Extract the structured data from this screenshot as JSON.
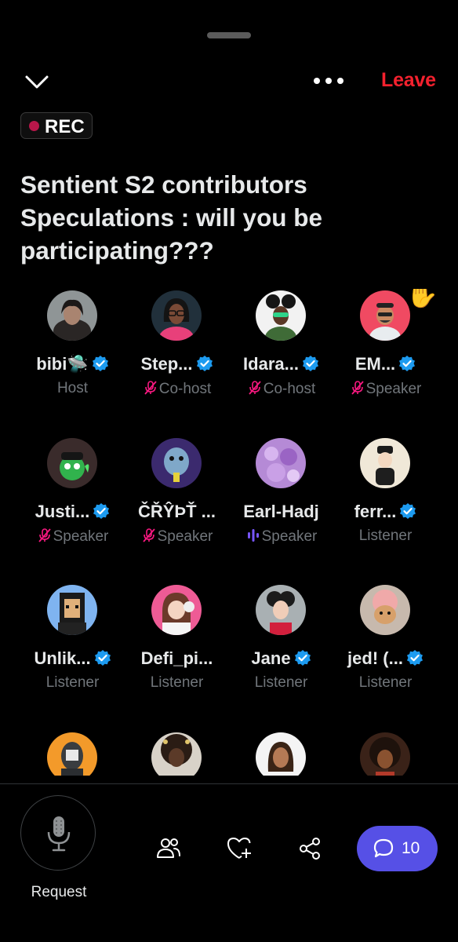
{
  "header": {
    "leave_label": "Leave",
    "rec_label": "REC"
  },
  "space": {
    "title": "Sentient S2 contributors Speculations : will you be participating???"
  },
  "participants": [
    {
      "name": "bibi🛸",
      "role": "Host",
      "verified": true,
      "role_icon": ""
    },
    {
      "name": "Step...",
      "role": "Co-host",
      "verified": true,
      "role_icon": "mic-off-icon"
    },
    {
      "name": "Idara...",
      "role": "Co-host",
      "verified": true,
      "role_icon": "mic-off-icon"
    },
    {
      "name": "EM...",
      "role": "Speaker",
      "verified": true,
      "role_icon": "mic-off-icon",
      "hand_raised": true
    },
    {
      "name": "Justi...",
      "role": "Speaker",
      "verified": true,
      "role_icon": "mic-off-icon"
    },
    {
      "name": "ČŘŶÞŤ ...",
      "role": "Speaker",
      "verified": false,
      "role_icon": "mic-off-icon"
    },
    {
      "name": "Earl-Hadj",
      "role": "Speaker",
      "verified": false,
      "role_icon": "speaking-icon"
    },
    {
      "name": "ferr...",
      "role": "Listener",
      "verified": true,
      "role_icon": ""
    },
    {
      "name": "Unlik...",
      "role": "Listener",
      "verified": true,
      "role_icon": ""
    },
    {
      "name": "Defi_pi...",
      "role": "Listener",
      "verified": false,
      "role_icon": ""
    },
    {
      "name": "Jane",
      "role": "Listener",
      "verified": true,
      "role_icon": ""
    },
    {
      "name": "jed! (...",
      "role": "Listener",
      "verified": true,
      "role_icon": ""
    },
    {
      "name": "",
      "role": "",
      "verified": false,
      "role_icon": ""
    },
    {
      "name": "",
      "role": "",
      "verified": false,
      "role_icon": ""
    },
    {
      "name": "",
      "role": "",
      "verified": false,
      "role_icon": ""
    },
    {
      "name": "",
      "role": "",
      "verified": false,
      "role_icon": ""
    }
  ],
  "footer": {
    "request_label": "Request",
    "chat_count": "10"
  },
  "colors": {
    "leave": "#f4212e",
    "rec_dot": "#b8174a",
    "verified": "#1d9bf0",
    "mic_off": "#f91880",
    "speaking": "#7856ff",
    "chat_button": "#5650e6"
  },
  "icons": {
    "handle": "drag-handle",
    "collapse": "chevron-down-icon",
    "more": "more-dots-icon",
    "mic": "microphone-icon",
    "people": "people-icon",
    "heart": "heart-plus-icon",
    "share": "share-icon",
    "chat": "chat-bubble-icon"
  }
}
